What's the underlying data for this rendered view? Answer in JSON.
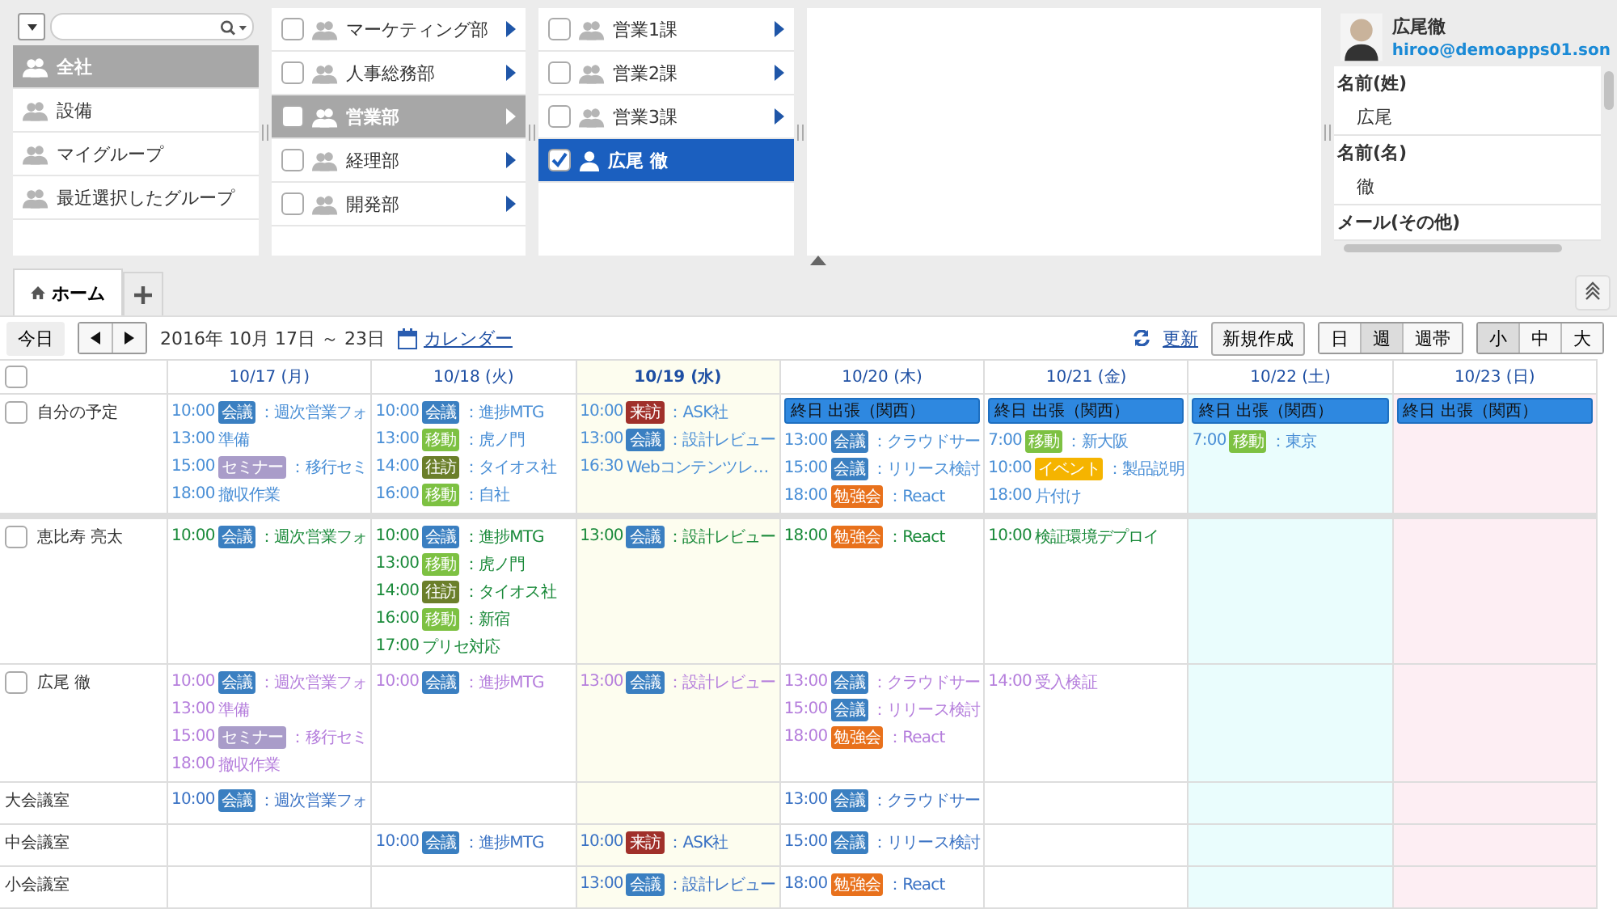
{
  "categories": [
    {
      "label": "全社",
      "selected": true
    },
    {
      "label": "設備",
      "selected": false
    },
    {
      "label": "マイグループ",
      "selected": false
    },
    {
      "label": "最近選択したグループ",
      "selected": false
    }
  ],
  "departments": [
    {
      "label": "マーケティング部",
      "checked": false,
      "selected": false
    },
    {
      "label": "人事総務部",
      "checked": false,
      "selected": false
    },
    {
      "label": "営業部",
      "checked": false,
      "selected": true
    },
    {
      "label": "経理部",
      "checked": false,
      "selected": false
    },
    {
      "label": "開発部",
      "checked": false,
      "selected": false
    }
  ],
  "members": [
    {
      "label": "営業1課",
      "kind": "group",
      "checked": false,
      "selected": false
    },
    {
      "label": "営業2課",
      "kind": "group",
      "checked": false,
      "selected": false
    },
    {
      "label": "営業3課",
      "kind": "group",
      "checked": false,
      "selected": false
    },
    {
      "label": "広尾 徹",
      "kind": "person",
      "checked": true,
      "selected": true
    }
  ],
  "profile": {
    "name": "広尾徹",
    "email": "hiroo@demoapps01.son",
    "fields": [
      {
        "label": "名前(姓)",
        "value": "広尾"
      },
      {
        "label": "名前(名)",
        "value": "徹"
      },
      {
        "label": "メール(その他)"
      }
    ]
  },
  "tabs": [
    {
      "label": "ホーム",
      "selected": true
    }
  ],
  "toolbar": {
    "today": "今日",
    "range": "2016年 10月 17日 ～ 23日",
    "calendar_link": "カレンダー",
    "refresh_link": "更新",
    "new_button": "新規作成",
    "views": [
      {
        "label": "日",
        "selected": false
      },
      {
        "label": "週",
        "selected": true
      },
      {
        "label": "週帯",
        "selected": false
      }
    ],
    "sizes": [
      {
        "label": "小",
        "selected": true
      },
      {
        "label": "中",
        "selected": false
      },
      {
        "label": "大",
        "selected": false
      }
    ]
  },
  "calendar": {
    "header_checked": false,
    "days": [
      {
        "label": "10/17 (月)",
        "kind": "weekday"
      },
      {
        "label": "10/18 (火)",
        "kind": "weekday"
      },
      {
        "label": "10/19 (水)",
        "kind": "today"
      },
      {
        "label": "10/20 (木)",
        "kind": "weekday"
      },
      {
        "label": "10/21 (金)",
        "kind": "weekday"
      },
      {
        "label": "10/22 (土)",
        "kind": "saturday"
      },
      {
        "label": "10/23 (日)",
        "kind": "sunday"
      }
    ],
    "rows": [
      {
        "label": "自分の予定",
        "kind": "person",
        "checked": false,
        "color": "#4a8fd6",
        "cells": [
          {
            "events": [
              {
                "time": "10:00",
                "tag": "会議",
                "color": "#3a7fc1",
                "title": "：週次営業フォ"
              },
              {
                "time": "13:00",
                "title": "準備"
              },
              {
                "time": "15:00",
                "tag": "セミナー",
                "color": "#a99cc9",
                "title": "：移行セミ"
              },
              {
                "time": "18:00",
                "title": "撤収作業"
              }
            ]
          },
          {
            "events": [
              {
                "time": "10:00",
                "tag": "会議",
                "color": "#3a7fc1",
                "title": "：進捗MTG"
              },
              {
                "time": "13:00",
                "tag": "移動",
                "color": "#7dc142",
                "title": "：虎ノ門"
              },
              {
                "time": "14:00",
                "tag": "往訪",
                "color": "#6b7f2a",
                "title": "：タイオス社"
              },
              {
                "time": "16:00",
                "tag": "移動",
                "color": "#7dc142",
                "title": "：自社"
              }
            ]
          },
          {
            "events": [
              {
                "time": "10:00",
                "tag": "来訪",
                "color": "#a0302a",
                "title": "：ASK社"
              },
              {
                "time": "13:00",
                "tag": "会議",
                "color": "#3a7fc1",
                "title": "：設計レビュー"
              },
              {
                "time": "16:30",
                "title": "Webコンテンツレ…"
              }
            ]
          },
          {
            "allday": "終日 出張（関西）",
            "events": [
              {
                "time": "13:00",
                "tag": "会議",
                "color": "#3a7fc1",
                "title": "：クラウドサー"
              },
              {
                "time": "15:00",
                "tag": "会議",
                "color": "#3a7fc1",
                "title": "：リリース検討"
              },
              {
                "time": "18:00",
                "tag": "勉強会",
                "color": "#e8711c",
                "title": "：React"
              }
            ]
          },
          {
            "allday": "終日 出張（関西）",
            "events": [
              {
                "time": "7:00",
                "tag": "移動",
                "color": "#7dc142",
                "title": "：新大阪"
              },
              {
                "time": "10:00",
                "tag": "イベント",
                "color": "#f5b400",
                "title": "：製品説明"
              },
              {
                "time": "18:00",
                "title": "片付け"
              }
            ]
          },
          {
            "allday": "終日 出張（関西）",
            "events": [
              {
                "time": "7:00",
                "tag": "移動",
                "color": "#7dc142",
                "title": "：東京"
              }
            ]
          },
          {
            "allday": "終日 出張（関西）"
          }
        ]
      },
      {
        "label": "恵比寿 亮太",
        "kind": "person",
        "checked": false,
        "color": "#1a8a3a",
        "cells": [
          {
            "events": [
              {
                "time": "10:00",
                "tag": "会議",
                "color": "#3a7fc1",
                "title": "：週次営業フォ"
              }
            ]
          },
          {
            "events": [
              {
                "time": "10:00",
                "tag": "会議",
                "color": "#3a7fc1",
                "title": "：進捗MTG"
              },
              {
                "time": "13:00",
                "tag": "移動",
                "color": "#7dc142",
                "title": "：虎ノ門"
              },
              {
                "time": "14:00",
                "tag": "往訪",
                "color": "#6b7f2a",
                "title": "：タイオス社"
              },
              {
                "time": "16:00",
                "tag": "移動",
                "color": "#7dc142",
                "title": "：新宿"
              },
              {
                "time": "17:00",
                "title": "プリセ対応"
              }
            ]
          },
          {
            "events": [
              {
                "time": "13:00",
                "tag": "会議",
                "color": "#3a7fc1",
                "title": "：設計レビュー"
              }
            ]
          },
          {
            "events": [
              {
                "time": "18:00",
                "tag": "勉強会",
                "color": "#e8711c",
                "title": "：React"
              }
            ]
          },
          {
            "events": [
              {
                "time": "10:00",
                "title": "検証環境デプロイ"
              }
            ]
          },
          {},
          {}
        ]
      },
      {
        "label": "広尾 徹",
        "kind": "person",
        "checked": false,
        "color": "#b57edc",
        "cells": [
          {
            "events": [
              {
                "time": "10:00",
                "tag": "会議",
                "color": "#3a7fc1",
                "title": "：週次営業フォ"
              },
              {
                "time": "13:00",
                "title": "準備"
              },
              {
                "time": "15:00",
                "tag": "セミナー",
                "color": "#a99cc9",
                "title": "：移行セミ"
              },
              {
                "time": "18:00",
                "title": "撤収作業"
              }
            ]
          },
          {
            "events": [
              {
                "time": "10:00",
                "tag": "会議",
                "color": "#3a7fc1",
                "title": "：進捗MTG"
              }
            ]
          },
          {
            "events": [
              {
                "time": "13:00",
                "tag": "会議",
                "color": "#3a7fc1",
                "title": "：設計レビュー"
              }
            ]
          },
          {
            "events": [
              {
                "time": "13:00",
                "tag": "会議",
                "color": "#3a7fc1",
                "title": "：クラウドサー"
              },
              {
                "time": "15:00",
                "tag": "会議",
                "color": "#3a7fc1",
                "title": "：リリース検討"
              },
              {
                "time": "18:00",
                "tag": "勉強会",
                "color": "#e8711c",
                "title": "：React"
              }
            ]
          },
          {
            "events": [
              {
                "time": "14:00",
                "title": "受入検証"
              }
            ]
          },
          {},
          {}
        ]
      },
      {
        "label": "大会議室",
        "kind": "room",
        "color": "#3a72c4",
        "cells": [
          {
            "events": [
              {
                "time": "10:00",
                "tag": "会議",
                "color": "#3a7fc1",
                "title": "：週次営業フォ"
              }
            ]
          },
          {},
          {},
          {
            "events": [
              {
                "time": "13:00",
                "tag": "会議",
                "color": "#3a7fc1",
                "title": "：クラウドサー"
              }
            ]
          },
          {},
          {},
          {}
        ]
      },
      {
        "label": "中会議室",
        "kind": "room",
        "color": "#3a72c4",
        "cells": [
          {},
          {
            "events": [
              {
                "time": "10:00",
                "tag": "会議",
                "color": "#3a7fc1",
                "title": "：進捗MTG"
              }
            ]
          },
          {
            "events": [
              {
                "time": "10:00",
                "tag": "来訪",
                "color": "#a0302a",
                "title": "：ASK社"
              }
            ]
          },
          {
            "events": [
              {
                "time": "15:00",
                "tag": "会議",
                "color": "#3a7fc1",
                "title": "：リリース検討"
              }
            ]
          },
          {},
          {},
          {}
        ]
      },
      {
        "label": "小会議室",
        "kind": "room",
        "color": "#3a72c4",
        "cells": [
          {},
          {},
          {
            "events": [
              {
                "time": "13:00",
                "tag": "会議",
                "color": "#3a7fc1",
                "title": "：設計レビュー"
              }
            ]
          },
          {
            "events": [
              {
                "time": "18:00",
                "tag": "勉強会",
                "color": "#e8711c",
                "title": "：React"
              }
            ]
          },
          {},
          {},
          {}
        ]
      }
    ]
  }
}
